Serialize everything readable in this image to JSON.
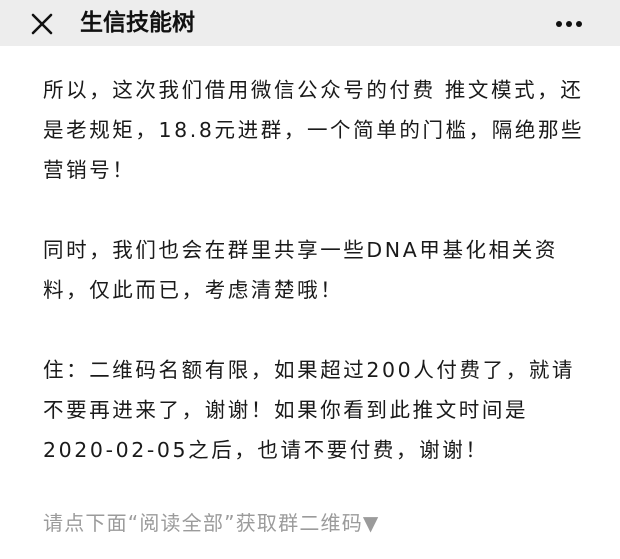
{
  "header": {
    "title": "生信技能树",
    "close_icon": "close-icon",
    "more_icon": "more-icon"
  },
  "article": {
    "paragraphs": [
      "所以，这次我们借用微信公众号的付费 推文模式，还是老规矩，18.8元进群，一个简单的门槛，隔绝那些营销号！",
      "同时，我们也会在群里共享一些DNA甲基化相关资料，仅此而已，考虑清楚哦！",
      "住：二维码名额有限，如果超过200人付费了，就请不要再进来了，谢谢！如果你看到此推文时间是2020-02-05之后，也请不要付费，谢谢！"
    ]
  },
  "footer": {
    "prompt": "请点下面“阅读全部”获取群二维码▼"
  },
  "colors": {
    "header_bg": "#ededed",
    "text": "#1a1a1a",
    "footer_text": "#9b9b9b"
  }
}
